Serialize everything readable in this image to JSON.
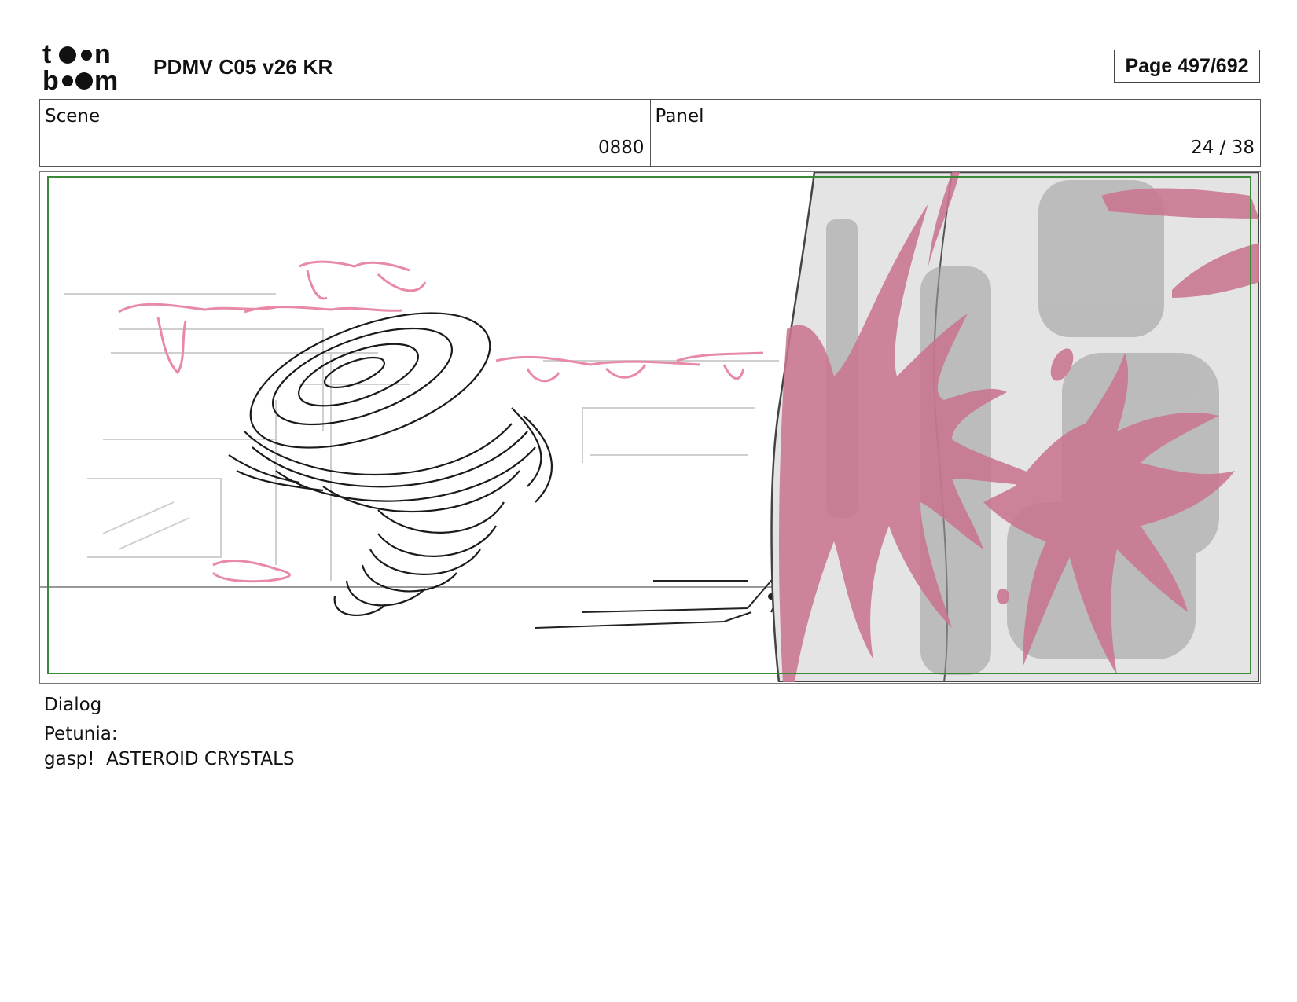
{
  "header": {
    "logo_text": "toon boom",
    "title": "PDMV C05 v26 KR",
    "page": "Page 497/692"
  },
  "info": {
    "scene_label": "Scene",
    "scene_value": "0880",
    "panel_label": "Panel",
    "panel_value": "24 / 38"
  },
  "dialog": {
    "label": "Dialog",
    "speaker": "Petunia:",
    "line": "gasp!  ASTEROID CRYSTALS"
  },
  "colors": {
    "frame_green": "#3a8a3a",
    "slime_pink": "#c9768f",
    "sketch_pink": "#e88aa6",
    "rock_gray": "#e4e4e4"
  }
}
